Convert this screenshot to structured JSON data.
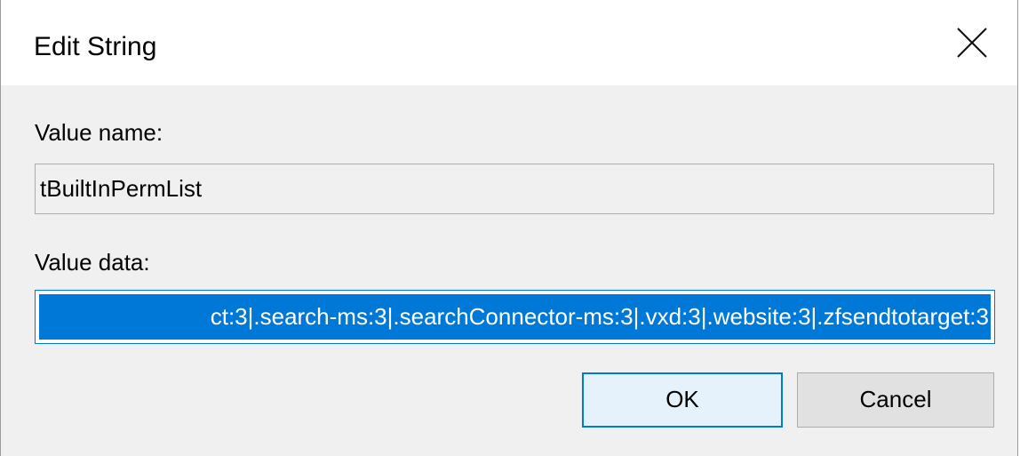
{
  "window": {
    "title": "Edit String"
  },
  "icons": {
    "close": "close-icon"
  },
  "value_name": {
    "label": "Value name:",
    "value": "tBuiltInPermList"
  },
  "value_data": {
    "label": "Value data:",
    "value": "ct:3|.search-ms:3|.searchConnector-ms:3|.vxd:3|.website:3|.zfsendtotarget:3"
  },
  "buttons": {
    "ok_label": "OK",
    "cancel_label": "Cancel"
  },
  "colors": {
    "accent": "#0078d7",
    "dialog_background": "#f0f0f0",
    "titlebar_background": "#ffffff"
  }
}
